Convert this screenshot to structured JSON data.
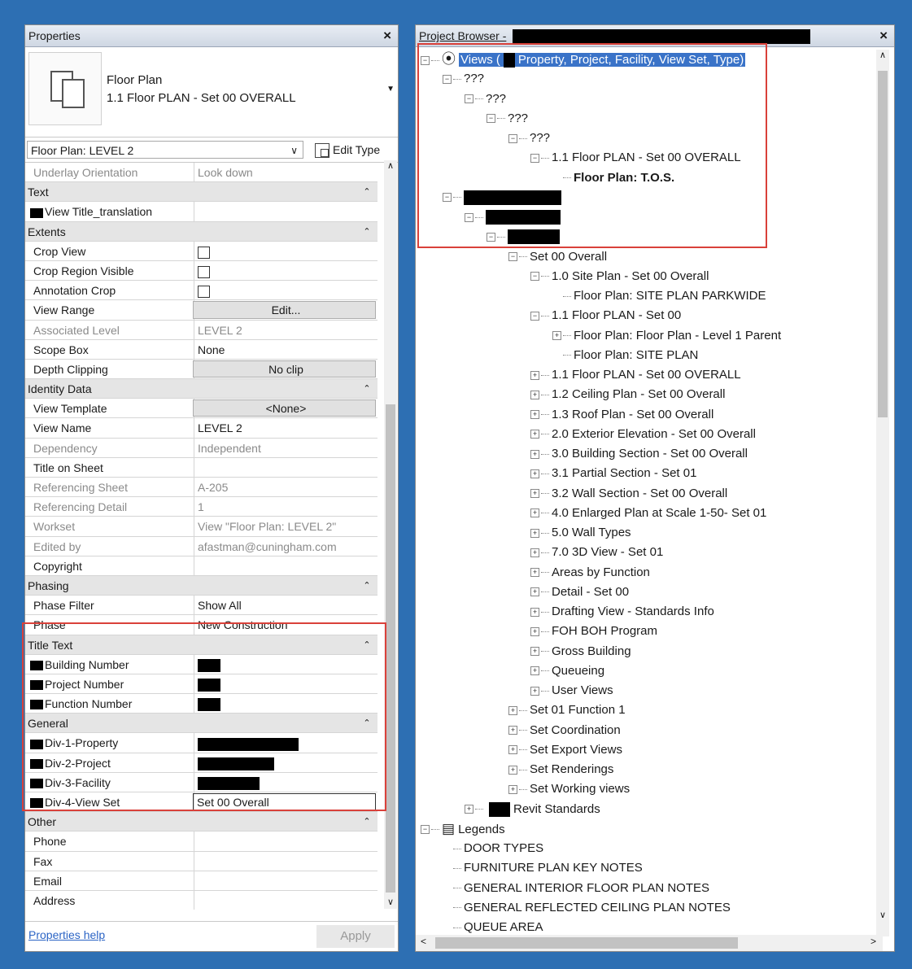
{
  "properties": {
    "title": "Properties",
    "close": "×",
    "type_family": "Floor Plan",
    "type_name": "1.1 Floor PLAN - Set 00 OVERALL",
    "instance_selector": "Floor Plan: LEVEL 2",
    "edit_type": "Edit Type",
    "rows": [
      {
        "kind": "prop",
        "key": "Underlay Orientation",
        "value": "Look down",
        "dim": true
      },
      {
        "kind": "group",
        "label": "Text"
      },
      {
        "kind": "prop",
        "key": "View Title_translation",
        "value": "",
        "redact_key": true
      },
      {
        "kind": "group",
        "label": "Extents"
      },
      {
        "kind": "prop",
        "key": "Crop View",
        "value": "",
        "check": true
      },
      {
        "kind": "prop",
        "key": "Crop Region Visible",
        "value": "",
        "check": true
      },
      {
        "kind": "prop",
        "key": "Annotation Crop",
        "value": "",
        "check": true
      },
      {
        "kind": "prop",
        "key": "View Range",
        "value": "Edit...",
        "button": true
      },
      {
        "kind": "prop",
        "key": "Associated Level",
        "value": "LEVEL 2",
        "dim": true
      },
      {
        "kind": "prop",
        "key": "Scope Box",
        "value": "None"
      },
      {
        "kind": "prop",
        "key": "Depth Clipping",
        "value": "No clip",
        "button": true
      },
      {
        "kind": "group",
        "label": "Identity Data"
      },
      {
        "kind": "prop",
        "key": "View Template",
        "value": "<None>",
        "button": true
      },
      {
        "kind": "prop",
        "key": "View Name",
        "value": "LEVEL 2"
      },
      {
        "kind": "prop",
        "key": "Dependency",
        "value": "Independent",
        "dim": true
      },
      {
        "kind": "prop",
        "key": "Title on Sheet",
        "value": ""
      },
      {
        "kind": "prop",
        "key": "Referencing Sheet",
        "value": "A-205",
        "dim": true
      },
      {
        "kind": "prop",
        "key": "Referencing Detail",
        "value": "1",
        "dim": true
      },
      {
        "kind": "prop",
        "key": "Workset",
        "value": "View \"Floor Plan: LEVEL 2\"",
        "dim": true
      },
      {
        "kind": "prop",
        "key": "Edited by",
        "value": "afastman@cuningham.com",
        "dim": true
      },
      {
        "kind": "prop",
        "key": "Copyright",
        "value": ""
      },
      {
        "kind": "group",
        "label": "Phasing"
      },
      {
        "kind": "prop",
        "key": "Phase Filter",
        "value": "Show All"
      },
      {
        "kind": "prop",
        "key": "Phase",
        "value": "New Construction"
      },
      {
        "kind": "group",
        "label": "Title Text"
      },
      {
        "kind": "prop",
        "key": "Building Number",
        "value": "",
        "redact_key": true,
        "redact_w": 28
      },
      {
        "kind": "prop",
        "key": "Project Number",
        "value": "",
        "redact_key": true,
        "redact_w": 28
      },
      {
        "kind": "prop",
        "key": "Function Number",
        "value": "",
        "redact_key": true,
        "redact_w": 28
      },
      {
        "kind": "group",
        "label": "General"
      },
      {
        "kind": "prop",
        "key": "Div-1-Property",
        "value": "",
        "redact_key": true,
        "redact_w": 124
      },
      {
        "kind": "prop",
        "key": "Div-2-Project",
        "value": "",
        "redact_key": true,
        "redact_w": 94
      },
      {
        "kind": "prop",
        "key": "Div-3-Facility",
        "value": "",
        "redact_key": true,
        "redact_w": 76
      },
      {
        "kind": "prop",
        "key": "Div-4-View Set",
        "value": "Set 00 Overall",
        "redact_key": true,
        "input": true
      },
      {
        "kind": "group",
        "label": "Other"
      },
      {
        "kind": "prop",
        "key": "Phone",
        "value": ""
      },
      {
        "kind": "prop",
        "key": "Fax",
        "value": ""
      },
      {
        "kind": "prop",
        "key": "Email",
        "value": ""
      },
      {
        "kind": "prop",
        "key": "Address",
        "value": ""
      }
    ],
    "help_link": "Properties help",
    "apply": "Apply"
  },
  "browser": {
    "title": "Project Browser -",
    "close": "×",
    "nodes": [
      {
        "t": "Views (",
        "tail": "Property, Project, Facility, View Set, Type)",
        "lvl": 0,
        "tog": "−",
        "icon": "views",
        "sel": true,
        "redact": 14
      },
      {
        "t": "???",
        "lvl": 1,
        "tog": "−"
      },
      {
        "t": "???",
        "lvl": 2,
        "tog": "−"
      },
      {
        "t": "???",
        "lvl": 3,
        "tog": "−"
      },
      {
        "t": "???",
        "lvl": 4,
        "tog": "−"
      },
      {
        "t": "1.1 Floor PLAN - Set 00 OVERALL",
        "lvl": 5,
        "tog": "−"
      },
      {
        "t": "Floor Plan: T.O.S.",
        "lvl": 6,
        "leaf": true,
        "bold": true
      },
      {
        "t": "",
        "lvl": 1,
        "tog": "−",
        "redact": 120
      },
      {
        "t": "",
        "lvl": 2,
        "tog": "−",
        "redact": 92
      },
      {
        "t": "",
        "lvl": 3,
        "tog": "−",
        "redact": 64
      },
      {
        "t": "Set 00 Overall",
        "lvl": 4,
        "tog": "−"
      },
      {
        "t": "1.0 Site Plan - Set 00 Overall",
        "lvl": 5,
        "tog": "−"
      },
      {
        "t": "Floor Plan: SITE PLAN PARKWIDE",
        "lvl": 6,
        "leaf": true
      },
      {
        "t": "1.1 Floor PLAN - Set 00",
        "lvl": 5,
        "tog": "−"
      },
      {
        "t": "Floor Plan: Floor Plan - Level 1 Parent",
        "lvl": 6,
        "tog": "+"
      },
      {
        "t": "Floor Plan: SITE PLAN",
        "lvl": 6,
        "leaf": true
      },
      {
        "t": "1.1 Floor PLAN - Set 00 OVERALL",
        "lvl": 5,
        "tog": "+"
      },
      {
        "t": "1.2 Ceiling Plan - Set 00 Overall",
        "lvl": 5,
        "tog": "+"
      },
      {
        "t": "1.3 Roof Plan - Set 00 Overall",
        "lvl": 5,
        "tog": "+"
      },
      {
        "t": "2.0 Exterior Elevation - Set 00 Overall",
        "lvl": 5,
        "tog": "+"
      },
      {
        "t": "3.0 Building Section - Set 00 Overall",
        "lvl": 5,
        "tog": "+"
      },
      {
        "t": "3.1 Partial Section - Set 01",
        "lvl": 5,
        "tog": "+"
      },
      {
        "t": "3.2 Wall Section - Set 00 Overall",
        "lvl": 5,
        "tog": "+"
      },
      {
        "t": "4.0 Enlarged Plan at Scale 1-50- Set 01",
        "lvl": 5,
        "tog": "+"
      },
      {
        "t": "5.0 Wall Types",
        "lvl": 5,
        "tog": "+"
      },
      {
        "t": "7.0 3D View - Set 01",
        "lvl": 5,
        "tog": "+"
      },
      {
        "t": "Areas by Function",
        "lvl": 5,
        "tog": "+"
      },
      {
        "t": "Detail - Set 00",
        "lvl": 5,
        "tog": "+"
      },
      {
        "t": "Drafting View - Standards Info",
        "lvl": 5,
        "tog": "+"
      },
      {
        "t": "FOH BOH Program",
        "lvl": 5,
        "tog": "+"
      },
      {
        "t": "Gross Building",
        "lvl": 5,
        "tog": "+"
      },
      {
        "t": "Queueing",
        "lvl": 5,
        "tog": "+"
      },
      {
        "t": "User Views",
        "lvl": 5,
        "tog": "+"
      },
      {
        "t": "Set 01 Function 1",
        "lvl": 4,
        "tog": "+"
      },
      {
        "t": "Set Coordination",
        "lvl": 4,
        "tog": "+"
      },
      {
        "t": "Set Export Views",
        "lvl": 4,
        "tog": "+"
      },
      {
        "t": "Set Renderings",
        "lvl": 4,
        "tog": "+"
      },
      {
        "t": "Set Working views",
        "lvl": 4,
        "tog": "+"
      },
      {
        "t": "Revit Standards",
        "lvl": 2,
        "tog": "+",
        "redact": 26
      },
      {
        "t": "Legends",
        "lvl": 0,
        "tog": "−",
        "icon": "legend"
      },
      {
        "t": "DOOR TYPES",
        "lvl": 1,
        "leaf": true
      },
      {
        "t": "FURNITURE PLAN KEY NOTES",
        "lvl": 1,
        "leaf": true
      },
      {
        "t": "GENERAL INTERIOR FLOOR PLAN NOTES",
        "lvl": 1,
        "leaf": true
      },
      {
        "t": "GENERAL REFLECTED CEILING PLAN NOTES",
        "lvl": 1,
        "leaf": true
      },
      {
        "t": "QUEUE AREA",
        "lvl": 1,
        "leaf": true
      }
    ]
  },
  "colors": {
    "highlight_box": "#d9413a",
    "selection": "#3a73c8",
    "group_bg": "#e5e5e5"
  }
}
